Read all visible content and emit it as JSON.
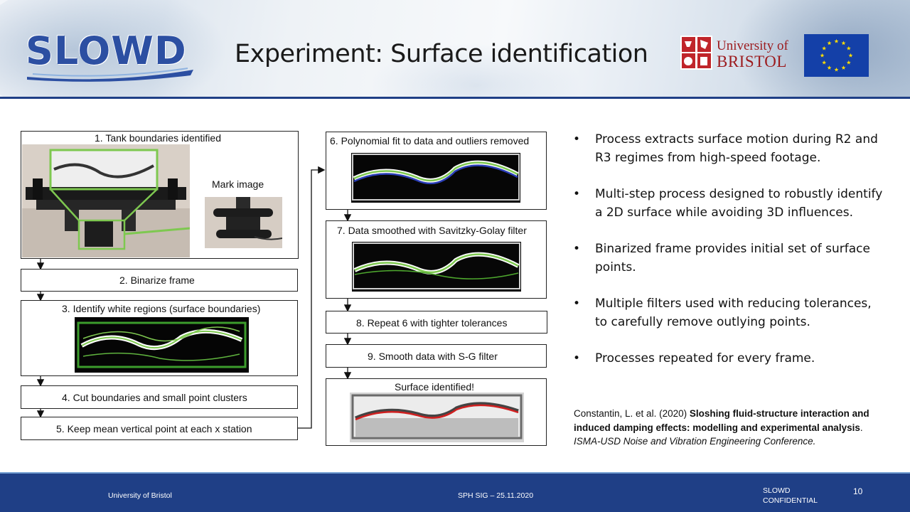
{
  "header": {
    "logo_text": "SLOWD",
    "title": "Experiment: Surface identification",
    "university_line1": "University of",
    "university_line2": "BRISTOL"
  },
  "flow": {
    "step1": "1. Tank boundaries identified",
    "mark_image": "Mark image",
    "step2": "2. Binarize frame",
    "step3": "3. Identify white regions (surface boundaries)",
    "step4": "4. Cut boundaries and small point clusters",
    "step5": "5. Keep mean vertical point at each x station",
    "step6": "6. Polynomial fit to data and outliers removed",
    "step7": "7. Data smoothed with Savitzky-Golay filter",
    "step8": "8. Repeat 6 with tighter tolerances",
    "step9": "9. Smooth data with S-G filter",
    "result": "Surface identified!"
  },
  "bullets": [
    "Process extracts surface motion during R2 and R3 regimes from high-speed footage.",
    "Multi-step process designed to robustly identify a 2D surface while avoiding 3D influences.",
    "Binarized frame provides initial set of surface points.",
    "Multiple filters used with reducing tolerances, to carefully remove outlying points.",
    "Processes repeated for every frame."
  ],
  "bullet_symbol": "•",
  "reference": {
    "authors": "Constantin, L. et al. (2020)",
    "title": "Sloshing fluid-structure interaction and induced damping effects: modelling and experimental analysis",
    "venue": "ISMA-USD Noise and Vibration Engineering Conference."
  },
  "footer": {
    "left": "University of Bristol",
    "center": "SPH SIG – 25.11.2020",
    "right_line1": "SLOWD",
    "right_line2": "CONFIDENTIAL",
    "page_number": "10"
  },
  "colors": {
    "brand_blue": "#1f3f86",
    "bristol_red": "#9c1b1e",
    "highlight_green": "#7ec850",
    "fit_blue": "#2b3fb8",
    "fit_red": "#d02020"
  }
}
